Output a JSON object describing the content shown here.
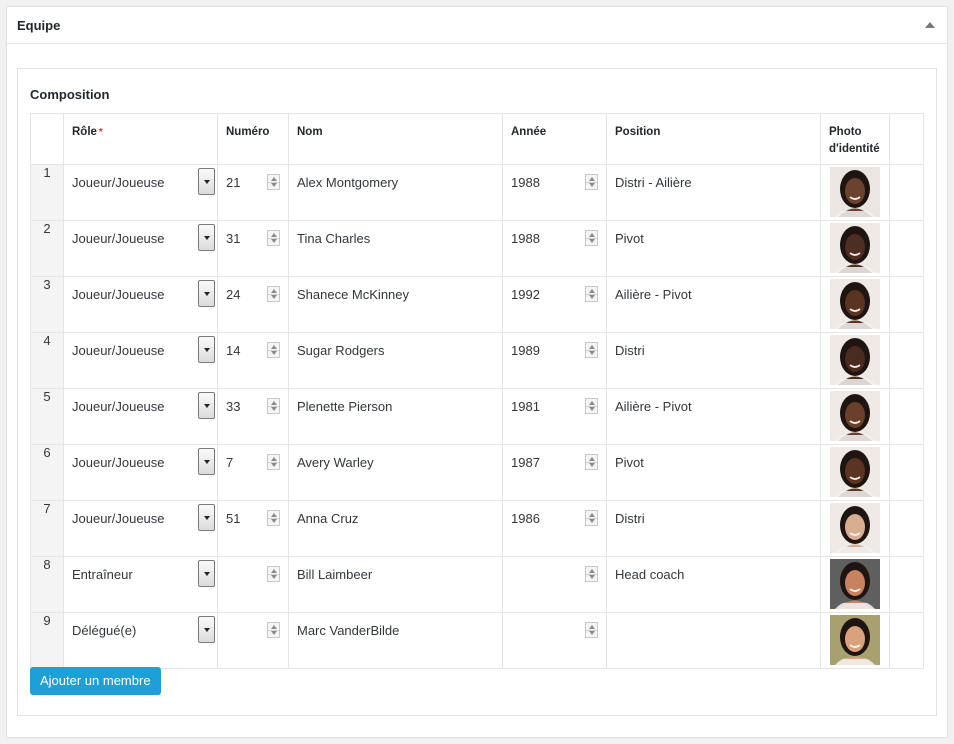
{
  "panel": {
    "title": "Equipe"
  },
  "section": {
    "title": "Composition"
  },
  "columns": {
    "role": "Rôle",
    "required_mark": "*",
    "number": "Numéro",
    "name": "Nom",
    "year": "Année",
    "position": "Position",
    "photo_line1": "Photo",
    "photo_line2": "d'identité"
  },
  "rows": [
    {
      "index": "1",
      "role": "Joueur/Joueuse",
      "number": "21",
      "name": "Alex Montgomery",
      "year": "1988",
      "position": "Distri - Ailière",
      "skin": "#6b4230",
      "bg": "#ece6e2"
    },
    {
      "index": "2",
      "role": "Joueur/Joueuse",
      "number": "31",
      "name": "Tina Charles",
      "year": "1988",
      "position": "Pivot",
      "skin": "#4e2e22",
      "bg": "#efeae6"
    },
    {
      "index": "3",
      "role": "Joueur/Joueuse",
      "number": "24",
      "name": "Shanece McKinney",
      "year": "1992",
      "position": "Ailière - Pivot",
      "skin": "#5a3323",
      "bg": "#efeae6"
    },
    {
      "index": "4",
      "role": "Joueur/Joueuse",
      "number": "14",
      "name": "Sugar Rodgers",
      "year": "1989",
      "position": "Distri",
      "skin": "#4a2b1f",
      "bg": "#efeae6"
    },
    {
      "index": "5",
      "role": "Joueur/Joueuse",
      "number": "33",
      "name": "Plenette Pierson",
      "year": "1981",
      "position": "Ailière - Pivot",
      "skin": "#6a402b",
      "bg": "#efeae6"
    },
    {
      "index": "6",
      "role": "Joueur/Joueuse",
      "number": "7",
      "name": "Avery Warley",
      "year": "1987",
      "position": "Pivot",
      "skin": "#5c3423",
      "bg": "#efeae6"
    },
    {
      "index": "7",
      "role": "Joueur/Joueuse",
      "number": "51",
      "name": "Anna Cruz",
      "year": "1986",
      "position": "Distri",
      "skin": "#d8ae92",
      "bg": "#efeae6"
    },
    {
      "index": "8",
      "role": "Entraîneur",
      "number": "",
      "name": "Bill Laimbeer",
      "year": "",
      "position": "Head coach",
      "skin": "#c7825f",
      "bg": "#5f5f5f"
    },
    {
      "index": "9",
      "role": "Délégué(e)",
      "number": "",
      "name": "Marc VanderBilde",
      "year": "",
      "position": "",
      "skin": "#d9a27c",
      "bg": "#a9a070"
    }
  ],
  "add_button": {
    "label": "Ajouter un membre"
  }
}
